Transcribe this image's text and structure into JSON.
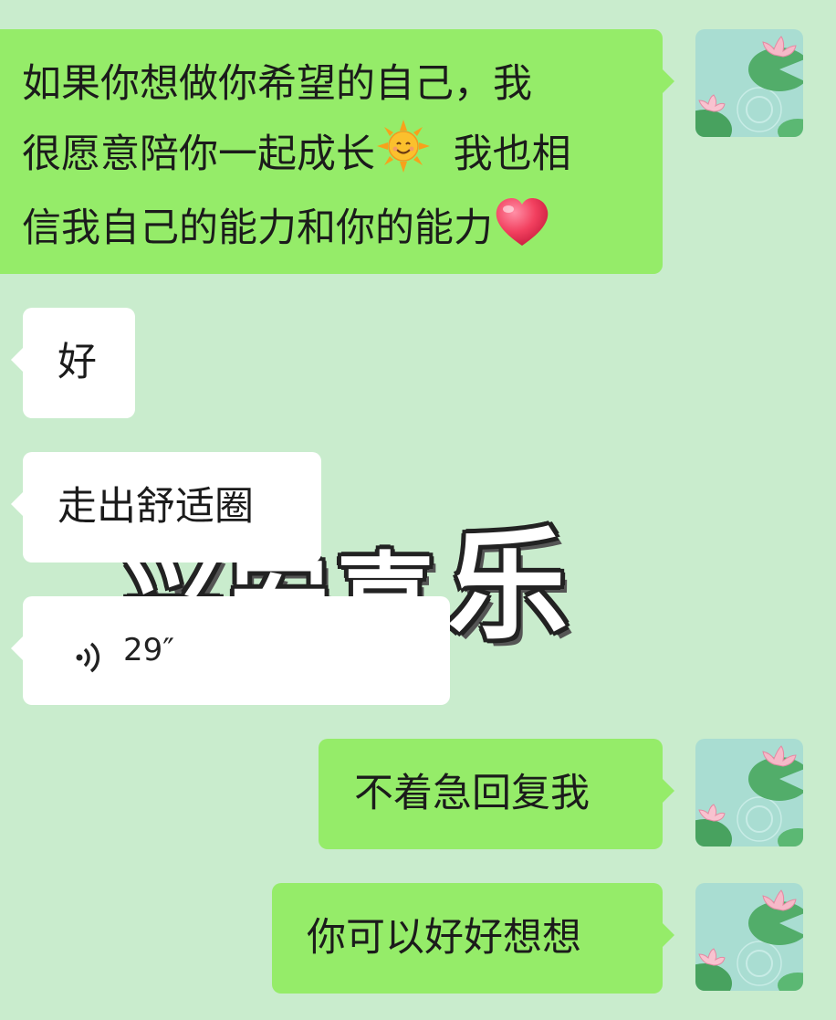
{
  "overlay": {
    "text": "乐",
    "partial_text": "兴安喜"
  },
  "messages": [
    {
      "side": "sent",
      "lines": [
        "如果你想做你希望的自己，我",
        "很愿意陪你一起成长",
        "我也相",
        "信我自己的能力和你的能力"
      ],
      "emojis": [
        "sun-smiley-emoji",
        "red-heart-emoji"
      ]
    },
    {
      "side": "received",
      "text": "好"
    },
    {
      "side": "received",
      "text": "走出舒适圈"
    },
    {
      "side": "received",
      "type": "voice",
      "duration": "29″"
    },
    {
      "side": "sent",
      "text": "不着急回复我"
    },
    {
      "side": "sent",
      "text": "你可以好好想想"
    }
  ],
  "avatar": {
    "icon": "lotus-pond-avatar"
  },
  "colors": {
    "background": "#c9eccd",
    "sent_bubble": "#95ec69",
    "received_bubble": "#ffffff"
  }
}
